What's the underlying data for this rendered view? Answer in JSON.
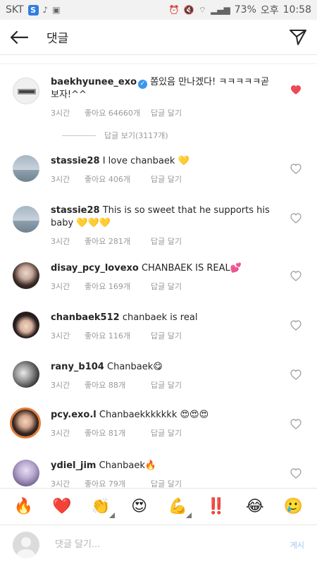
{
  "status_bar": {
    "carrier": "SKT",
    "battery": "73%",
    "time_period": "오후",
    "time": "10:58"
  },
  "header": {
    "title": "댓글"
  },
  "comments": [
    {
      "username": "baekhyunee_exo",
      "verified": true,
      "text": "쫌있음 만나겠다! ㅋㅋㅋㅋㅋ곧보자!^^",
      "time": "3시간",
      "likes": "좋아요 64660개",
      "reply": "답글 달기",
      "liked": true
    },
    {
      "username": "stassie28",
      "text": "I love chanbaek 💛",
      "time": "3시간",
      "likes": "좋아요 406개",
      "reply": "답글 달기"
    },
    {
      "username": "stassie28",
      "text": "This is so sweet that he supports his baby 💛💛💛",
      "time": "3시간",
      "likes": "좋아요 281개",
      "reply": "답글 달기"
    },
    {
      "username": "disay_pcy_lovexo",
      "text": "CHANBAEK IS REAL💕",
      "time": "3시간",
      "likes": "좋아요 169개",
      "reply": "답글 달기"
    },
    {
      "username": "chanbaek512",
      "text": "chanbaek  is  real",
      "time": "3시간",
      "likes": "좋아요 116개",
      "reply": "답글 달기"
    },
    {
      "username": "rany_b104",
      "text": "Chanbaek😋",
      "time": "3시간",
      "likes": "좋아요 88개",
      "reply": "답글 달기"
    },
    {
      "username": "pcy.exo.l",
      "text": "Chanbaekkkkkkk 😍😍😍",
      "time": "3시간",
      "likes": "좋아요 81개",
      "reply": "답글 달기"
    },
    {
      "username": "ydiel_jim",
      "text": "Chanbaek🔥",
      "time": "3시간",
      "likes": "좋아요 79개",
      "reply": "답글 달기"
    }
  ],
  "view_replies": "답글 보기(3117개)",
  "emoji_bar": [
    "🔥",
    "❤️",
    "👏",
    "😍",
    "💪",
    "‼️",
    "😂",
    "🥲"
  ],
  "input": {
    "placeholder": "댓글 달기...",
    "post_label": "게시"
  },
  "colors": {
    "liked_heart": "#ed4956",
    "verified_badge": "#3897f0",
    "post_button": "#9cc5f0"
  }
}
